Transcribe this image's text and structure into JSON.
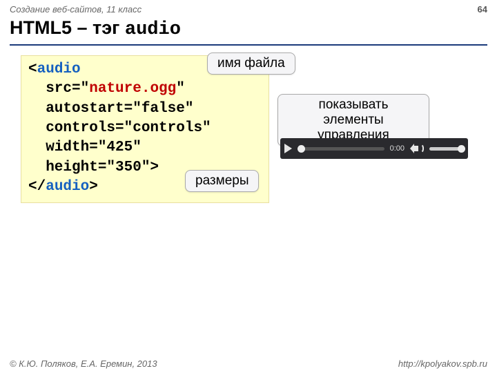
{
  "header": {
    "course": "Создание веб-сайтов, 11 класс",
    "page_num": "64"
  },
  "title": {
    "prefix": "HTML5 – тэг ",
    "tag": "audio"
  },
  "code": {
    "open_lt": "<",
    "open_tag": "audio",
    "attr1_name": "  src=",
    "attr1_q": "\"",
    "attr1_val": "nature.ogg",
    "attr2_line": "  autostart=\"false\"",
    "attr3_line": "  controls=\"controls\"",
    "attr4_line": "  width=\"425\"",
    "attr5_line": "  height=\"350\">",
    "close_lt": "</",
    "close_tag": "audio",
    "close_gt": ">"
  },
  "callouts": {
    "filename": "имя файла",
    "controls_l1": "показывать элементы",
    "controls_l2": "управления",
    "sizes": "размеры"
  },
  "player": {
    "time": "0:00"
  },
  "footer": {
    "copyright": "© К.Ю. Поляков, Е.А. Еремин, 2013",
    "url": "http://kpolyakov.spb.ru"
  }
}
